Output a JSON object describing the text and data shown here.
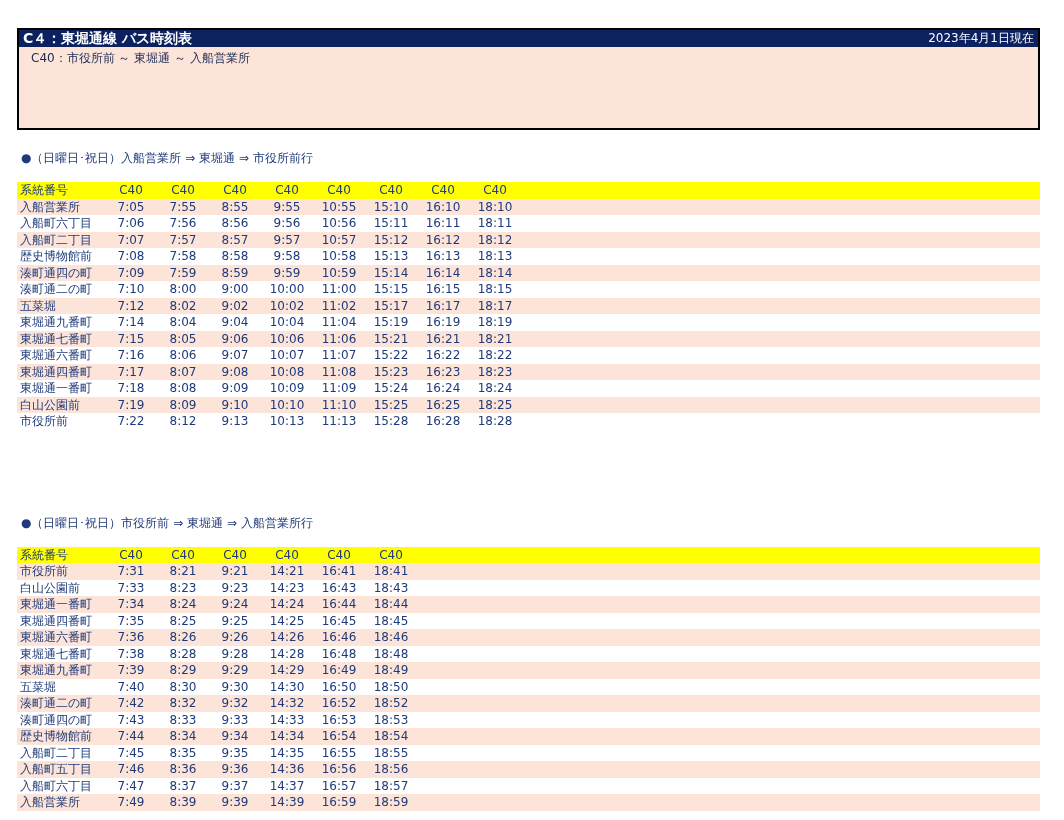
{
  "header": {
    "title": "C４：東堀通線 バス時刻表",
    "date": "2023年4月1日現在",
    "route": "C40：市役所前 ～ 東堀通 ～ 入船営業所"
  },
  "sections": [
    {
      "heading": "●（日曜日･祝日）入船営業所 ⇒ 東堀通 ⇒ 市役所前行",
      "columns": [
        "系統番号",
        "C40",
        "C40",
        "C40",
        "C40",
        "C40",
        "C40",
        "C40",
        "C40"
      ],
      "rows": [
        {
          "stop": "入船営業所",
          "times": [
            "7:05",
            "7:55",
            "8:55",
            "9:55",
            "10:55",
            "15:10",
            "16:10",
            "18:10"
          ]
        },
        {
          "stop": "入船町六丁目",
          "times": [
            "7:06",
            "7:56",
            "8:56",
            "9:56",
            "10:56",
            "15:11",
            "16:11",
            "18:11"
          ]
        },
        {
          "stop": "入船町二丁目",
          "times": [
            "7:07",
            "7:57",
            "8:57",
            "9:57",
            "10:57",
            "15:12",
            "16:12",
            "18:12"
          ]
        },
        {
          "stop": "歴史博物館前",
          "times": [
            "7:08",
            "7:58",
            "8:58",
            "9:58",
            "10:58",
            "15:13",
            "16:13",
            "18:13"
          ]
        },
        {
          "stop": "湊町通四の町",
          "times": [
            "7:09",
            "7:59",
            "8:59",
            "9:59",
            "10:59",
            "15:14",
            "16:14",
            "18:14"
          ]
        },
        {
          "stop": "湊町通二の町",
          "times": [
            "7:10",
            "8:00",
            "9:00",
            "10:00",
            "11:00",
            "15:15",
            "16:15",
            "18:15"
          ]
        },
        {
          "stop": "五菜堀",
          "times": [
            "7:12",
            "8:02",
            "9:02",
            "10:02",
            "11:02",
            "15:17",
            "16:17",
            "18:17"
          ]
        },
        {
          "stop": "東堀通九番町",
          "times": [
            "7:14",
            "8:04",
            "9:04",
            "10:04",
            "11:04",
            "15:19",
            "16:19",
            "18:19"
          ]
        },
        {
          "stop": "東堀通七番町",
          "times": [
            "7:15",
            "8:05",
            "9:06",
            "10:06",
            "11:06",
            "15:21",
            "16:21",
            "18:21"
          ]
        },
        {
          "stop": "東堀通六番町",
          "times": [
            "7:16",
            "8:06",
            "9:07",
            "10:07",
            "11:07",
            "15:22",
            "16:22",
            "18:22"
          ]
        },
        {
          "stop": "東堀通四番町",
          "times": [
            "7:17",
            "8:07",
            "9:08",
            "10:08",
            "11:08",
            "15:23",
            "16:23",
            "18:23"
          ]
        },
        {
          "stop": "東堀通一番町",
          "times": [
            "7:18",
            "8:08",
            "9:09",
            "10:09",
            "11:09",
            "15:24",
            "16:24",
            "18:24"
          ]
        },
        {
          "stop": "白山公園前",
          "times": [
            "7:19",
            "8:09",
            "9:10",
            "10:10",
            "11:10",
            "15:25",
            "16:25",
            "18:25"
          ]
        },
        {
          "stop": "市役所前",
          "times": [
            "7:22",
            "8:12",
            "9:13",
            "10:13",
            "11:13",
            "15:28",
            "16:28",
            "18:28"
          ]
        }
      ]
    },
    {
      "heading": "●（日曜日･祝日）市役所前 ⇒ 東堀通 ⇒ 入船営業所行",
      "columns": [
        "系統番号",
        "C40",
        "C40",
        "C40",
        "C40",
        "C40",
        "C40"
      ],
      "rows": [
        {
          "stop": "市役所前",
          "times": [
            "7:31",
            "8:21",
            "9:21",
            "14:21",
            "16:41",
            "18:41"
          ]
        },
        {
          "stop": "白山公園前",
          "times": [
            "7:33",
            "8:23",
            "9:23",
            "14:23",
            "16:43",
            "18:43"
          ]
        },
        {
          "stop": "東堀通一番町",
          "times": [
            "7:34",
            "8:24",
            "9:24",
            "14:24",
            "16:44",
            "18:44"
          ]
        },
        {
          "stop": "東堀通四番町",
          "times": [
            "7:35",
            "8:25",
            "9:25",
            "14:25",
            "16:45",
            "18:45"
          ]
        },
        {
          "stop": "東堀通六番町",
          "times": [
            "7:36",
            "8:26",
            "9:26",
            "14:26",
            "16:46",
            "18:46"
          ]
        },
        {
          "stop": "東堀通七番町",
          "times": [
            "7:38",
            "8:28",
            "9:28",
            "14:28",
            "16:48",
            "18:48"
          ]
        },
        {
          "stop": "東堀通九番町",
          "times": [
            "7:39",
            "8:29",
            "9:29",
            "14:29",
            "16:49",
            "18:49"
          ]
        },
        {
          "stop": "五菜堀",
          "times": [
            "7:40",
            "8:30",
            "9:30",
            "14:30",
            "16:50",
            "18:50"
          ]
        },
        {
          "stop": "湊町通二の町",
          "times": [
            "7:42",
            "8:32",
            "9:32",
            "14:32",
            "16:52",
            "18:52"
          ]
        },
        {
          "stop": "湊町通四の町",
          "times": [
            "7:43",
            "8:33",
            "9:33",
            "14:33",
            "16:53",
            "18:53"
          ]
        },
        {
          "stop": "歴史博物館前",
          "times": [
            "7:44",
            "8:34",
            "9:34",
            "14:34",
            "16:54",
            "18:54"
          ]
        },
        {
          "stop": "入船町二丁目",
          "times": [
            "7:45",
            "8:35",
            "9:35",
            "14:35",
            "16:55",
            "18:55"
          ]
        },
        {
          "stop": "入船町五丁目",
          "times": [
            "7:46",
            "8:36",
            "9:36",
            "14:36",
            "16:56",
            "18:56"
          ]
        },
        {
          "stop": "入船町六丁目",
          "times": [
            "7:47",
            "8:37",
            "9:37",
            "14:37",
            "16:57",
            "18:57"
          ]
        },
        {
          "stop": "入船営業所",
          "times": [
            "7:49",
            "8:39",
            "9:39",
            "14:39",
            "16:59",
            "18:59"
          ]
        }
      ]
    }
  ]
}
